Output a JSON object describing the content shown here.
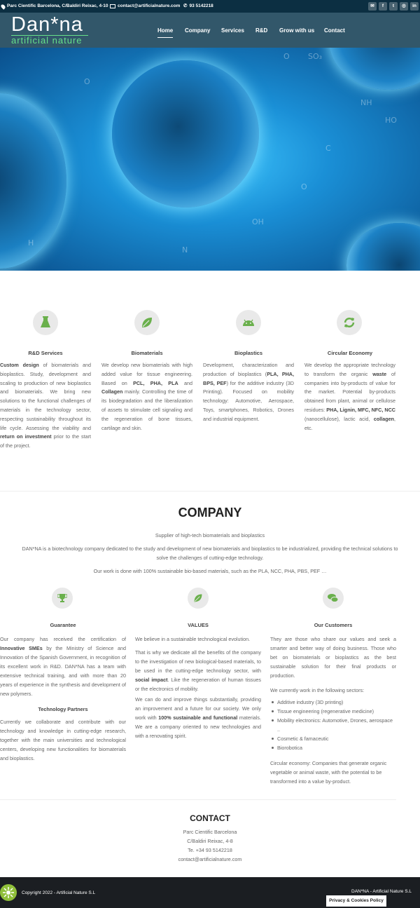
{
  "topbar": {
    "address": "Parc Cientific Barcelona, C/Baldiri Reixac, 4-10",
    "email": "contact@artificialnature.com",
    "phone": "93 5142218",
    "socials": [
      "mail-icon",
      "facebook-icon",
      "twitter-icon",
      "instagram-icon",
      "linkedin-icon"
    ]
  },
  "logo": {
    "main": "Dan*na",
    "sub": "artificial nature"
  },
  "nav": [
    "Home",
    "Company",
    "Services",
    "R&D",
    "Grow with us",
    "Contact"
  ],
  "services": [
    {
      "icon": "flask-icon",
      "title": "R&D Services",
      "text": [
        [
          "Custom design",
          true
        ],
        [
          " of biomaterials and bioplastics. Study, development and scaling to production of new bioplastics and biomaterials. We bring new solutions to the functional challenges of materials in the technology sector, respecting sustainability throughout its life cycle. Assessing the viability and ",
          false
        ],
        [
          "return on investment",
          true
        ],
        [
          " prior to the start of the project.",
          false
        ]
      ]
    },
    {
      "icon": "leaf-icon",
      "title": "Biomaterials",
      "text": [
        [
          "We develop new biomaterials with high added value for tissue engineering. Based on ",
          false
        ],
        [
          "PCL, PHA, PLA",
          true
        ],
        [
          " and ",
          false
        ],
        [
          "Collagen",
          true
        ],
        [
          " mainly. Controlling the time of its biodegradation and the liberalization of assets to stimulate cell signaling and the regeneration of bone tissues, cartilage and skin.",
          false
        ]
      ]
    },
    {
      "icon": "android-icon",
      "title": "Bioplastics",
      "text": [
        [
          "Development, characterization and production of bioplastics (",
          false
        ],
        [
          "PLA, PHA, BPS, PEF",
          true
        ],
        [
          ") for the additive industry (3D Printing). Focused on mobility technology: Automotive, Aerospace, Toys, smartphones, Robotics, Drones and industrial equipment.",
          false
        ]
      ]
    },
    {
      "icon": "recycle-icon",
      "title": "Circular Economy",
      "text": [
        [
          "We develop the appropriate technology to transform the organic ",
          false
        ],
        [
          "waste",
          true
        ],
        [
          " of companies into by-products of value for the market. Potential by-products obtained from plant, animal or cellulose residues: ",
          false
        ],
        [
          "PHA, Lignin, MFC, NFC, NCC",
          true
        ],
        [
          " (nanocellulose), lactic acid, ",
          false
        ],
        [
          "collagen",
          true
        ],
        [
          ", etc.",
          false
        ]
      ]
    }
  ],
  "company": {
    "title": "COMPANY",
    "subtitle": "Supplier of high-tech biomaterials and bioplastics",
    "intro": "DAN*NA is a biotechnology company dedicated to the study and development of new biomaterials and bioplastics to be industrialized, providing the technical solutions to solve the challenges of cutting-edge technology.",
    "materials": "Our work is done with 100% sustainable bio-based materials, such as the PLA, NCC, PHA, PBS, PEF …"
  },
  "columns": {
    "guarantee": {
      "icon": "trophy-icon",
      "title": "Guarantee",
      "text": [
        [
          "Our company has received the certification of ",
          false
        ],
        [
          "Innovative SMEs",
          true
        ],
        [
          " by the Ministry of Science and Innovation of the Spanish Government, in recognition of its excellent work in R&D. DAN*NA has a team with extensive technical training, and with more than 20 years of experience in the synthesis and development of new polymers.",
          false
        ]
      ],
      "partners_title": "Technology Partners",
      "partners_text": "Currently we collaborate and contribute with our technology and knowledge in cutting-edge research, together with the main universities and technological centers, developing new functionalities for biomaterials and bioplastics."
    },
    "values": {
      "icon": "leaf-icon",
      "title": "VALUES",
      "p1": "We believe in a sustainable technological evolution.",
      "p2": [
        [
          "That is why we dedicate all the benefits of the company to the investigation of new biological-based materials, to be used in the cutting-edge technology sector, with ",
          false
        ],
        [
          "social impact",
          true
        ],
        [
          ". Like the regeneration of human tissues or the electronics of mobility.",
          false
        ]
      ],
      "p3": [
        [
          "We can do and improve things substantially, providing an improvement and a future for our society. We only work with ",
          false
        ],
        [
          "100% sustainable and functional",
          true
        ],
        [
          " materials. We are a company oriented to new technologies and with a renovating spirit.",
          false
        ]
      ]
    },
    "customers": {
      "icon": "chat-icon",
      "title": "Our Customers",
      "p1": "They are those who share our values and seek a smarter and better way of doing business. Those who bet on biomaterials or bioplastics as the best sustainable solution for their final products or production.",
      "p2": "We currently work in the following sectors:",
      "sectors": [
        "Additive industry (3D printing)",
        "Tissue engineering (regenerative medicine)",
        "Mobility electronics: Automotive, Drones, aerospace ..",
        "Cosmetic & famaceutic",
        "Biorobotica"
      ],
      "p3": "Circular economy: Companies that generate organic vegetable or animal waste, with the potential to be transformed into a value by-product."
    }
  },
  "contact": {
    "title": "CONTACT",
    "lines": [
      "Parc Cientific Barcelona",
      "C/Baldiri Reixac, 4-8",
      "Te. +34 93 5142218",
      "contact@artificialnature.com"
    ]
  },
  "footer": {
    "copyright": "Copyright 2022 - Artificial Nature S.L",
    "right": "DAN*NA - Artificial Nature S.L",
    "privacy": "Privacy & Cookies Policy"
  },
  "colors": {
    "accent": "#6ab04c",
    "topbar": "#0c2f42",
    "footer": "#1b1e22"
  }
}
